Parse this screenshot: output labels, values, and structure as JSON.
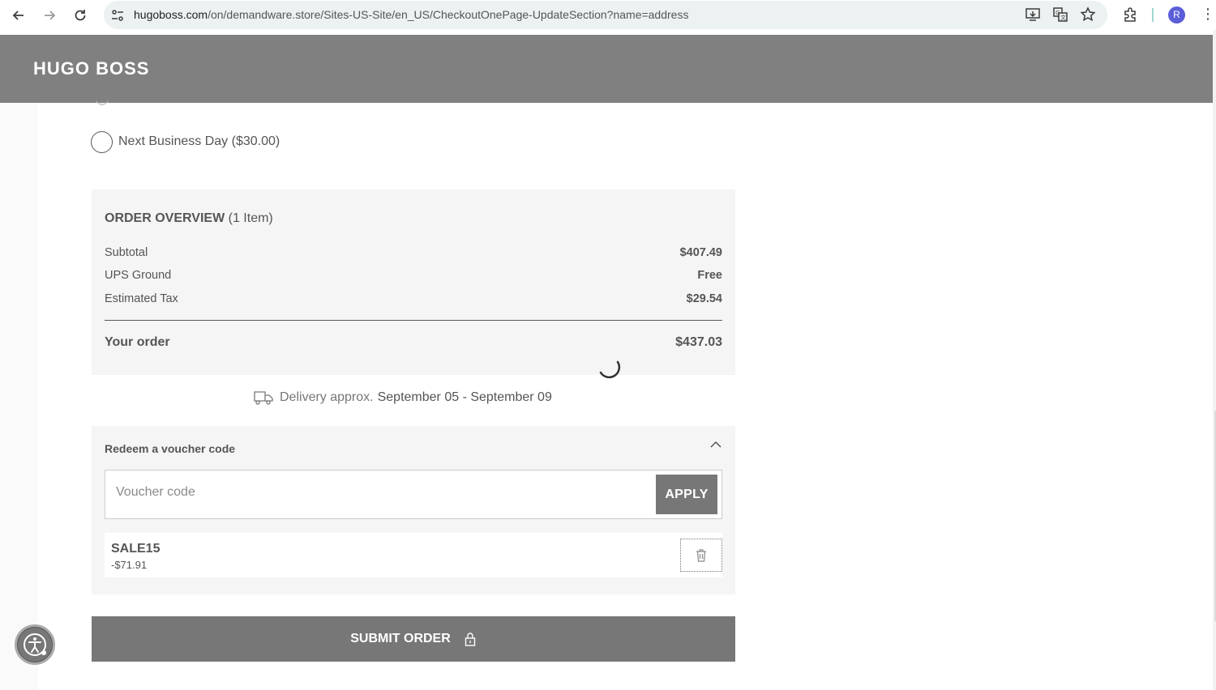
{
  "browser": {
    "url_host": "hugoboss.com",
    "url_path": "/on/demandware.store/Sites-US-Site/en_US/CheckoutOnePage-UpdateSection?name=address",
    "profile_initial": "R",
    "icons": [
      "back-icon",
      "forward-icon",
      "reload-icon",
      "site-info-icon",
      "install-app-icon",
      "translate-icon",
      "bookmark-star-icon",
      "extensions-icon",
      "menu-icon"
    ]
  },
  "header": {
    "logo": "HUGO BOSS"
  },
  "shipping": {
    "option_label": "Next Business Day ($30.00)"
  },
  "overview": {
    "title": "ORDER OVERVIEW",
    "item_count": "(1 Item)",
    "rows": [
      {
        "label": "Subtotal",
        "value": "$407.49"
      },
      {
        "label": "UPS Ground",
        "value": "Free"
      },
      {
        "label": "Estimated Tax",
        "value": "$29.54"
      }
    ],
    "total_label": "Your order",
    "total_value": "$437.03"
  },
  "delivery": {
    "prefix": "Delivery approx.",
    "dates": "September 05 - September 09"
  },
  "voucher": {
    "title": "Redeem a voucher code",
    "placeholder": "Voucher code",
    "apply_label": "APPLY",
    "applied_code": "SALE15",
    "applied_amount": "-$71.91"
  },
  "submit": {
    "label": "SUBMIT ORDER"
  },
  "colors": {
    "header_bg": "#808080",
    "panel_bg": "#f5f5f5",
    "button_bg": "#777777"
  }
}
